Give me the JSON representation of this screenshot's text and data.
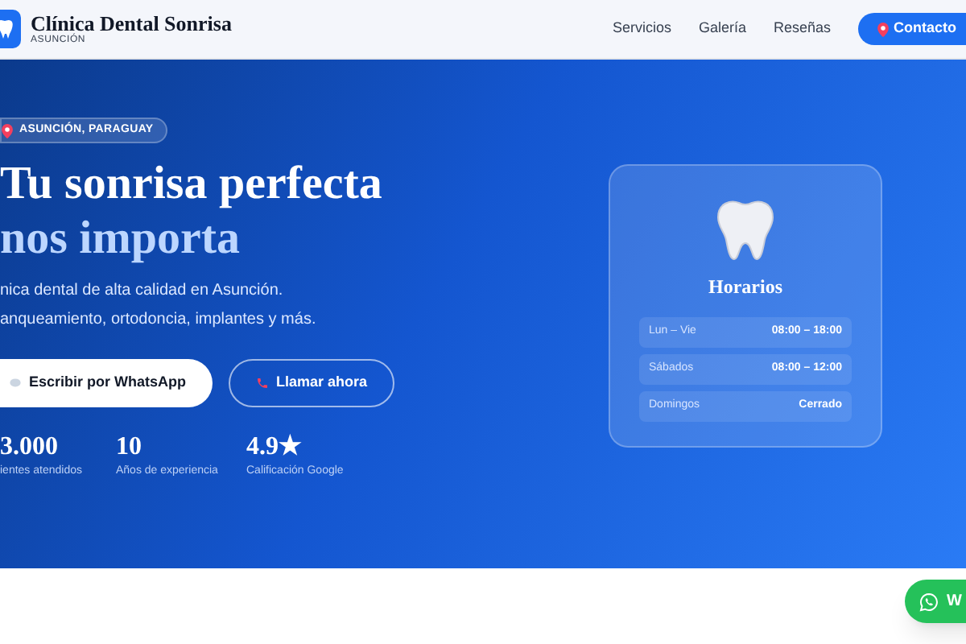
{
  "header": {
    "brand_name": "Clínica Dental Sonrisa",
    "brand_sub": "ASUNCIÓN",
    "nav": [
      {
        "label": "Servicios"
      },
      {
        "label": "Galería"
      },
      {
        "label": "Reseñas"
      }
    ],
    "contact_button": "Contacto"
  },
  "hero": {
    "badge": "ASUNCIÓN, PARAGUAY",
    "title_line1": "Tu sonrisa perfecta",
    "title_line2": "nos importa",
    "description_lines": [
      "nica dental de alta calidad en Asunción.",
      "anqueamiento, ortodoncia, implantes y más."
    ],
    "buttons": [
      {
        "kind": "whatsapp",
        "label": "Escribir por WhatsApp"
      },
      {
        "kind": "call",
        "label": "Llamar ahora"
      }
    ],
    "stats": [
      {
        "value": "3.000",
        "label": "ientes atendidos"
      },
      {
        "value": "10",
        "label": "Años de experiencia"
      },
      {
        "value": "4.9★",
        "label": "Calificación Google"
      }
    ]
  },
  "hours_card": {
    "title": "Horarios",
    "rows": [
      {
        "day": "Lun – Vie",
        "time": "08:00 – 18:00"
      },
      {
        "day": "Sábados",
        "time": "08:00 – 12:00"
      },
      {
        "day": "Domingos",
        "time": "Cerrado"
      }
    ]
  },
  "whatsapp_float": {
    "label": "W"
  }
}
